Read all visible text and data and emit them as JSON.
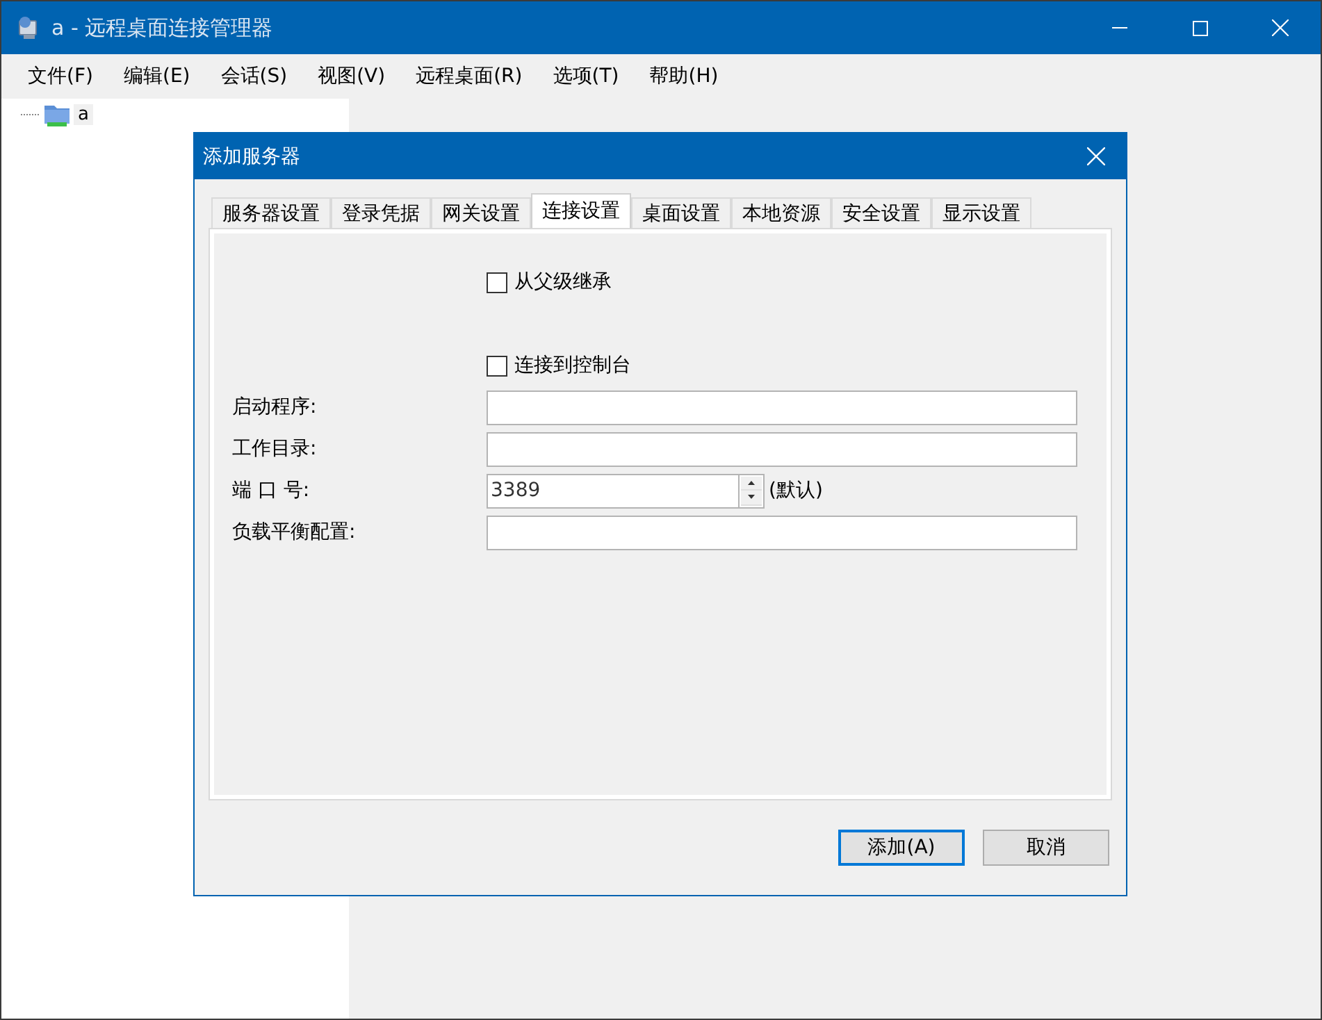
{
  "window": {
    "title": "a - 远程桌面连接管理器"
  },
  "menu": [
    "文件(F)",
    "编辑(E)",
    "会话(S)",
    "视图(V)",
    "远程桌面(R)",
    "选项(T)",
    "帮助(H)"
  ],
  "tree": [
    {
      "label": "a",
      "selected": false
    }
  ],
  "dialog": {
    "title": "添加服务器",
    "tabs": [
      {
        "label": "服务器设置",
        "selected": false
      },
      {
        "label": "登录凭据",
        "selected": false
      },
      {
        "label": "网关设置",
        "selected": false
      },
      {
        "label": "连接设置",
        "selected": true
      },
      {
        "label": "桌面设置",
        "selected": false
      },
      {
        "label": "本地资源",
        "selected": false
      },
      {
        "label": "安全设置",
        "selected": false
      },
      {
        "label": "显示设置",
        "selected": false
      }
    ],
    "rows": [
      {
        "kind": "checkbox",
        "label": "从父级继承",
        "checked": false
      },
      {
        "kind": "gap"
      },
      {
        "kind": "checkbox",
        "label": "连接到控制台",
        "checked": false
      },
      {
        "kind": "text",
        "label": "启动程序:"
      },
      {
        "kind": "text",
        "label": "工作目录:"
      },
      {
        "kind": "spinner",
        "label": "端 口 号:",
        "value": "3389",
        "suffix": "(默认)"
      },
      {
        "kind": "text",
        "label": "负载平衡配置:"
      }
    ],
    "buttons": [
      {
        "label": "添加(A)",
        "default": true
      },
      {
        "label": "取消",
        "default": false
      }
    ]
  }
}
